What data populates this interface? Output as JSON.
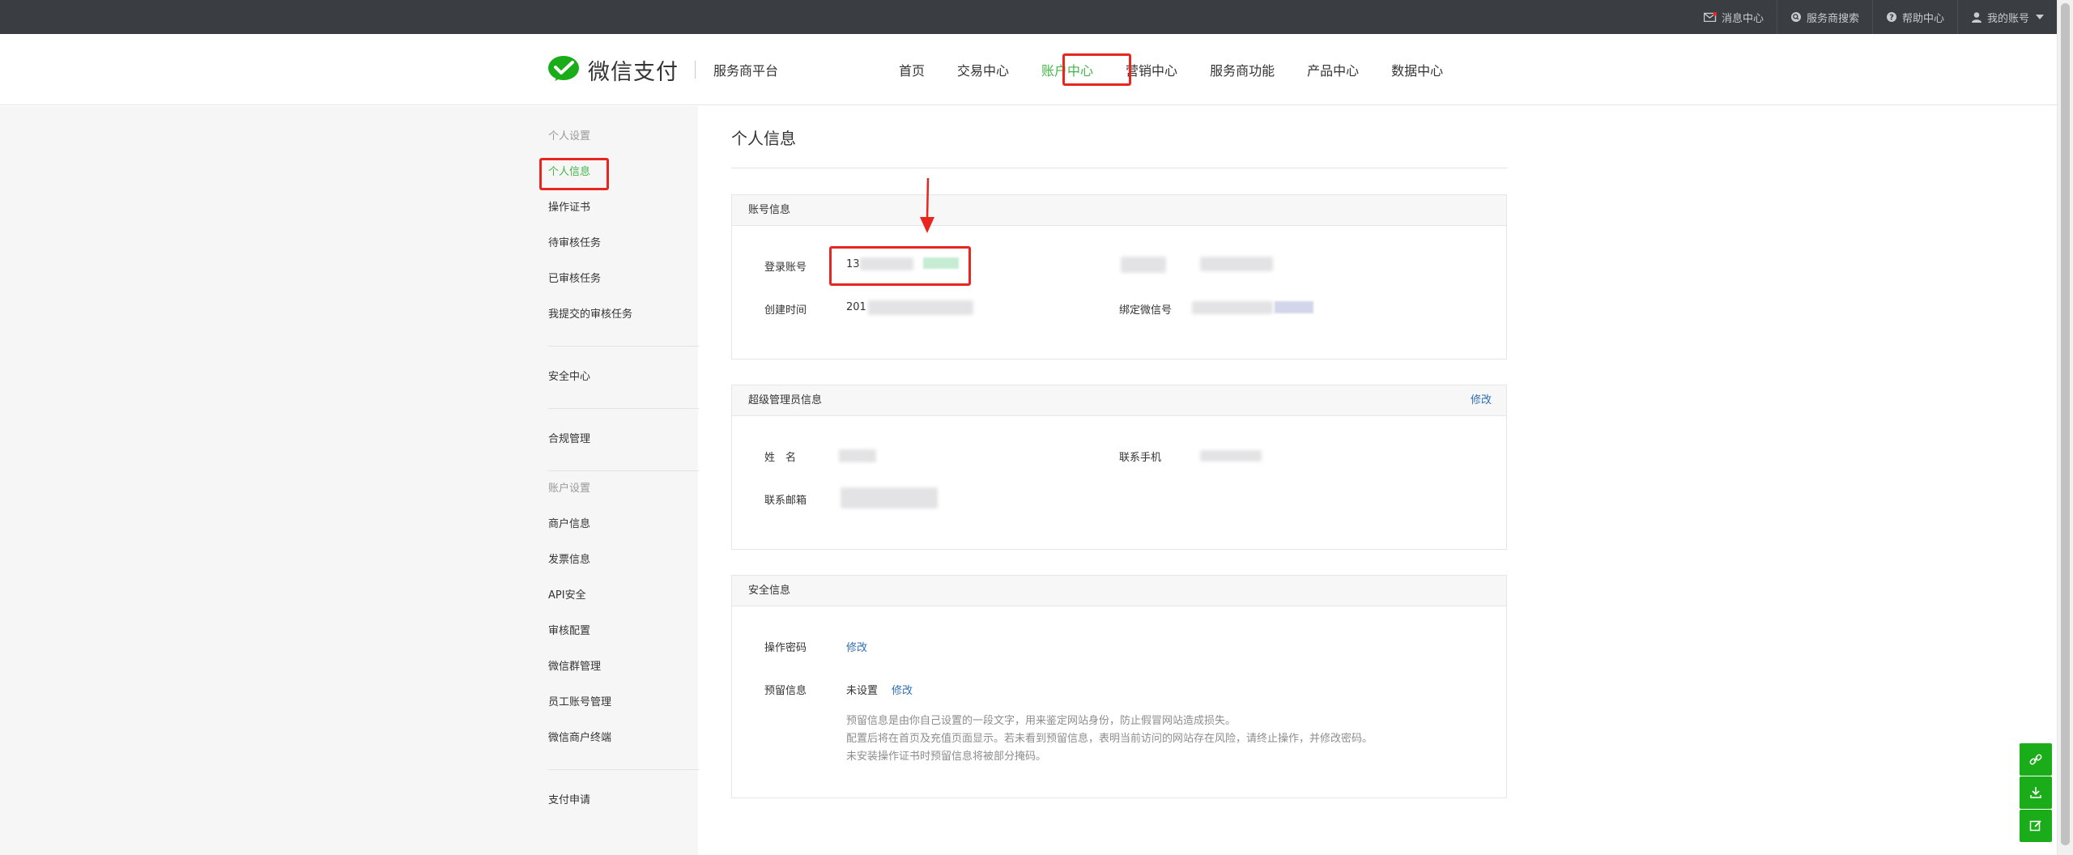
{
  "topbar": {
    "items": [
      {
        "label": "消息中心",
        "icon": "mail-icon"
      },
      {
        "label": "服务商搜索",
        "icon": "search-icon"
      },
      {
        "label": "帮助中心",
        "icon": "help-icon"
      },
      {
        "label": "我的账号",
        "icon": "user-icon"
      }
    ]
  },
  "header": {
    "logo_text": "微信支付",
    "logo_sub": "服务商平台",
    "nav": [
      "首页",
      "交易中心",
      "账户中心",
      "营销中心",
      "服务商功能",
      "产品中心",
      "数据中心"
    ],
    "active_nav": "账户中心"
  },
  "sidebar": {
    "group1_title": "个人设置",
    "group1_items": [
      "个人信息",
      "操作证书",
      "待审核任务",
      "已审核任务",
      "我提交的审核任务"
    ],
    "security": "安全中心",
    "compliance": "合规管理",
    "group2_title": "账户设置",
    "group2_items": [
      "商户信息",
      "发票信息",
      "API安全",
      "审核配置",
      "微信群管理",
      "员工账号管理",
      "微信商户终端"
    ],
    "pay_apply": "支付申请"
  },
  "main": {
    "page_title": "个人信息",
    "account": {
      "title": "账号信息",
      "login_label": "登录账号",
      "login_value_prefix": "13",
      "created_label": "创建时间",
      "created_value_prefix": "201",
      "wechat_label": "绑定微信号"
    },
    "admin": {
      "title": "超级管理员信息",
      "edit": "修改",
      "name_label": "姓　名",
      "phone_label": "联系手机",
      "email_label": "联系邮箱"
    },
    "security": {
      "title": "安全信息",
      "pwd_label": "操作密码",
      "pwd_edit": "修改",
      "reserved_label": "预留信息",
      "reserved_status": "未设置",
      "reserved_edit": "修改",
      "notes": [
        "预留信息是由你自己设置的一段文字，用来鉴定网站身份，防止假冒网站造成损失。",
        "配置后将在首页及充值页面显示。若未看到预留信息，表明当前访问的网站存在风险，请终止操作，并修改密码。",
        "未安装操作证书时预留信息将被部分掩码。"
      ]
    }
  },
  "colors": {
    "accent": "#44b549",
    "topbar": "#3a3d42",
    "link": "#2f6eb5",
    "annotation": "#e8261f"
  }
}
